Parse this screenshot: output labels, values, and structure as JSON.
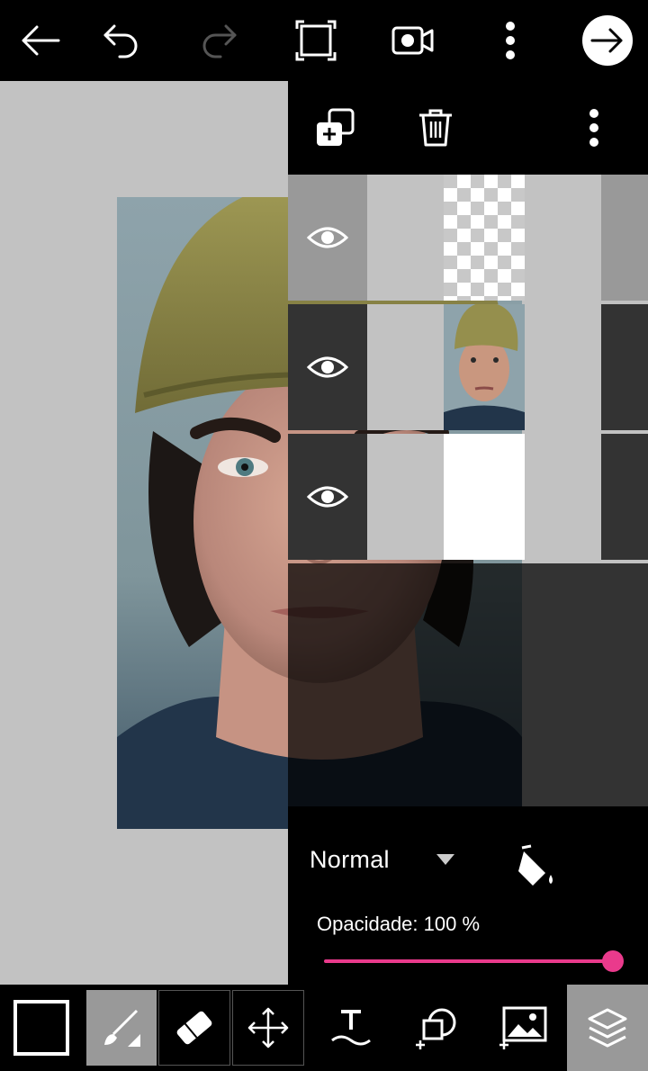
{
  "topbar": {
    "icons": [
      "back-arrow-icon",
      "undo-icon",
      "redo-icon",
      "crop-frame-icon",
      "video-record-icon",
      "more-vertical-icon",
      "next-arrow-icon"
    ]
  },
  "layers_panel": {
    "header_icons": [
      "duplicate-layer-icon",
      "delete-layer-icon",
      "more-vertical-icon"
    ],
    "layers": [
      {
        "visible": true,
        "content": "transparent"
      },
      {
        "visible": true,
        "content": "portrait-photo"
      },
      {
        "visible": true,
        "content": "white-background"
      }
    ],
    "blend_mode": "Normal",
    "opacity_label": "Opacidade: 100 %",
    "opacity_value": 100
  },
  "bottombar": {
    "tools": [
      "color-swatch",
      "brush-tool-icon",
      "eraser-tool-icon",
      "move-tool-icon",
      "text-tool-icon",
      "add-sticker-icon",
      "add-photo-icon",
      "layers-icon"
    ],
    "active_tool": "brush-tool-icon"
  },
  "colors": {
    "accent": "#ea3a8c",
    "canvas_bg": "#c2c2c2",
    "toolbar_bg": "#000000"
  }
}
